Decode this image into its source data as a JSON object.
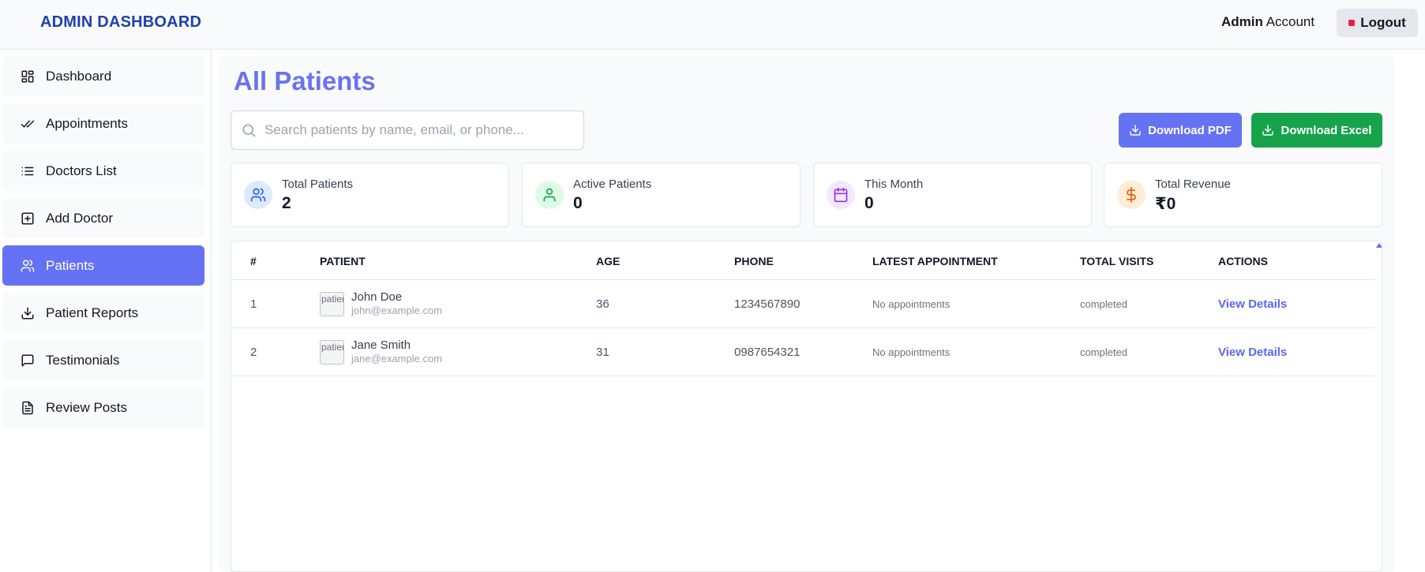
{
  "header": {
    "brand": "ADMIN DASHBOARD",
    "account_strong": "Admin",
    "account_rest": "Account",
    "logout_label": "Logout"
  },
  "sidebar": {
    "items": [
      {
        "label": "Dashboard",
        "icon": "grid-icon"
      },
      {
        "label": "Appointments",
        "icon": "double-check-icon"
      },
      {
        "label": "Doctors List",
        "icon": "list-icon"
      },
      {
        "label": "Add Doctor",
        "icon": "plus-square-icon"
      },
      {
        "label": "Patients",
        "icon": "users-icon",
        "active": true
      },
      {
        "label": "Patient Reports",
        "icon": "download-icon"
      },
      {
        "label": "Testimonials",
        "icon": "message-square-icon"
      },
      {
        "label": "Review Posts",
        "icon": "file-text-icon"
      }
    ]
  },
  "main": {
    "title": "All Patients",
    "search_placeholder": "Search patients by name, email, or phone...",
    "download_pdf": "Download PDF",
    "download_excel": "Download Excel"
  },
  "stats": [
    {
      "label": "Total Patients",
      "value": "2",
      "icon": "users-icon",
      "color": "#2563eb",
      "bg": "#dbeafe"
    },
    {
      "label": "Active Patients",
      "value": "0",
      "icon": "user-icon",
      "color": "#16a34a",
      "bg": "#dcfce7"
    },
    {
      "label": "This Month",
      "value": "0",
      "icon": "calendar-icon",
      "color": "#9333ea",
      "bg": "#f3e8ff"
    },
    {
      "label": "Total Revenue",
      "value": "₹0",
      "icon": "dollar-icon",
      "color": "#ea580c",
      "bg": "#ffedd5"
    }
  ],
  "table": {
    "headers": [
      "#",
      "PATIENT",
      "AGE",
      "PHONE",
      "LATEST APPOINTMENT",
      "TOTAL VISITS",
      "ACTIONS"
    ],
    "rows": [
      {
        "num": "1",
        "name": "John Doe",
        "email": "john@example.com",
        "age": "36",
        "phone": "1234567890",
        "latest": "No appointments",
        "visits": "completed",
        "action": "View Details",
        "avatar_alt": "patient"
      },
      {
        "num": "2",
        "name": "Jane Smith",
        "email": "jane@example.com",
        "age": "31",
        "phone": "0987654321",
        "latest": "No appointments",
        "visits": "completed",
        "action": "View Details",
        "avatar_alt": "patient"
      }
    ]
  },
  "colors": {
    "accent": "#6572f3",
    "brand": "#1e40af",
    "excel": "#16a34a",
    "logout_dot": "#e11d48"
  }
}
